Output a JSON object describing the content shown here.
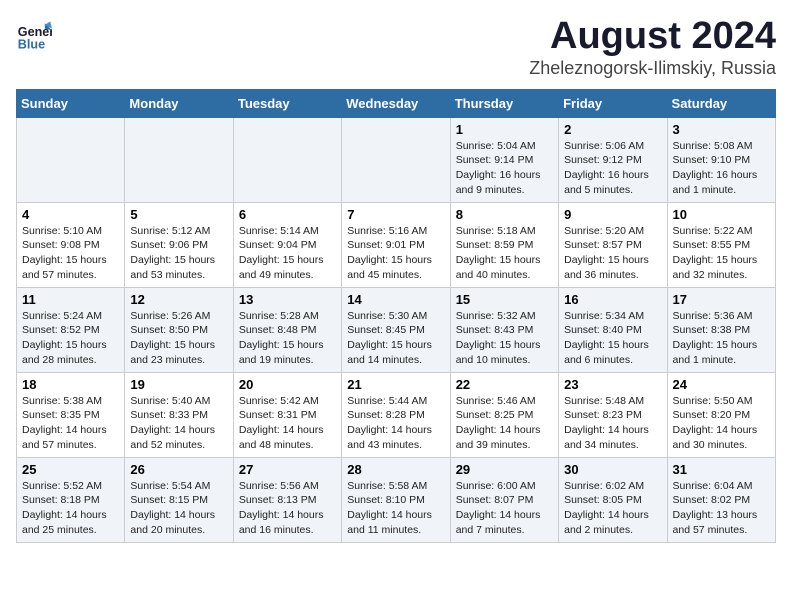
{
  "logo": {
    "line1": "General",
    "line2": "Blue"
  },
  "title": "August 2024",
  "subtitle": "Zheleznogorsk-Ilimskiy, Russia",
  "days_of_week": [
    "Sunday",
    "Monday",
    "Tuesday",
    "Wednesday",
    "Thursday",
    "Friday",
    "Saturday"
  ],
  "weeks": [
    [
      {
        "day": "",
        "text": ""
      },
      {
        "day": "",
        "text": ""
      },
      {
        "day": "",
        "text": ""
      },
      {
        "day": "",
        "text": ""
      },
      {
        "day": "1",
        "text": "Sunrise: 5:04 AM\nSunset: 9:14 PM\nDaylight: 16 hours\nand 9 minutes."
      },
      {
        "day": "2",
        "text": "Sunrise: 5:06 AM\nSunset: 9:12 PM\nDaylight: 16 hours\nand 5 minutes."
      },
      {
        "day": "3",
        "text": "Sunrise: 5:08 AM\nSunset: 9:10 PM\nDaylight: 16 hours\nand 1 minute."
      }
    ],
    [
      {
        "day": "4",
        "text": "Sunrise: 5:10 AM\nSunset: 9:08 PM\nDaylight: 15 hours\nand 57 minutes."
      },
      {
        "day": "5",
        "text": "Sunrise: 5:12 AM\nSunset: 9:06 PM\nDaylight: 15 hours\nand 53 minutes."
      },
      {
        "day": "6",
        "text": "Sunrise: 5:14 AM\nSunset: 9:04 PM\nDaylight: 15 hours\nand 49 minutes."
      },
      {
        "day": "7",
        "text": "Sunrise: 5:16 AM\nSunset: 9:01 PM\nDaylight: 15 hours\nand 45 minutes."
      },
      {
        "day": "8",
        "text": "Sunrise: 5:18 AM\nSunset: 8:59 PM\nDaylight: 15 hours\nand 40 minutes."
      },
      {
        "day": "9",
        "text": "Sunrise: 5:20 AM\nSunset: 8:57 PM\nDaylight: 15 hours\nand 36 minutes."
      },
      {
        "day": "10",
        "text": "Sunrise: 5:22 AM\nSunset: 8:55 PM\nDaylight: 15 hours\nand 32 minutes."
      }
    ],
    [
      {
        "day": "11",
        "text": "Sunrise: 5:24 AM\nSunset: 8:52 PM\nDaylight: 15 hours\nand 28 minutes."
      },
      {
        "day": "12",
        "text": "Sunrise: 5:26 AM\nSunset: 8:50 PM\nDaylight: 15 hours\nand 23 minutes."
      },
      {
        "day": "13",
        "text": "Sunrise: 5:28 AM\nSunset: 8:48 PM\nDaylight: 15 hours\nand 19 minutes."
      },
      {
        "day": "14",
        "text": "Sunrise: 5:30 AM\nSunset: 8:45 PM\nDaylight: 15 hours\nand 14 minutes."
      },
      {
        "day": "15",
        "text": "Sunrise: 5:32 AM\nSunset: 8:43 PM\nDaylight: 15 hours\nand 10 minutes."
      },
      {
        "day": "16",
        "text": "Sunrise: 5:34 AM\nSunset: 8:40 PM\nDaylight: 15 hours\nand 6 minutes."
      },
      {
        "day": "17",
        "text": "Sunrise: 5:36 AM\nSunset: 8:38 PM\nDaylight: 15 hours\nand 1 minute."
      }
    ],
    [
      {
        "day": "18",
        "text": "Sunrise: 5:38 AM\nSunset: 8:35 PM\nDaylight: 14 hours\nand 57 minutes."
      },
      {
        "day": "19",
        "text": "Sunrise: 5:40 AM\nSunset: 8:33 PM\nDaylight: 14 hours\nand 52 minutes."
      },
      {
        "day": "20",
        "text": "Sunrise: 5:42 AM\nSunset: 8:31 PM\nDaylight: 14 hours\nand 48 minutes."
      },
      {
        "day": "21",
        "text": "Sunrise: 5:44 AM\nSunset: 8:28 PM\nDaylight: 14 hours\nand 43 minutes."
      },
      {
        "day": "22",
        "text": "Sunrise: 5:46 AM\nSunset: 8:25 PM\nDaylight: 14 hours\nand 39 minutes."
      },
      {
        "day": "23",
        "text": "Sunrise: 5:48 AM\nSunset: 8:23 PM\nDaylight: 14 hours\nand 34 minutes."
      },
      {
        "day": "24",
        "text": "Sunrise: 5:50 AM\nSunset: 8:20 PM\nDaylight: 14 hours\nand 30 minutes."
      }
    ],
    [
      {
        "day": "25",
        "text": "Sunrise: 5:52 AM\nSunset: 8:18 PM\nDaylight: 14 hours\nand 25 minutes."
      },
      {
        "day": "26",
        "text": "Sunrise: 5:54 AM\nSunset: 8:15 PM\nDaylight: 14 hours\nand 20 minutes."
      },
      {
        "day": "27",
        "text": "Sunrise: 5:56 AM\nSunset: 8:13 PM\nDaylight: 14 hours\nand 16 minutes."
      },
      {
        "day": "28",
        "text": "Sunrise: 5:58 AM\nSunset: 8:10 PM\nDaylight: 14 hours\nand 11 minutes."
      },
      {
        "day": "29",
        "text": "Sunrise: 6:00 AM\nSunset: 8:07 PM\nDaylight: 14 hours\nand 7 minutes."
      },
      {
        "day": "30",
        "text": "Sunrise: 6:02 AM\nSunset: 8:05 PM\nDaylight: 14 hours\nand 2 minutes."
      },
      {
        "day": "31",
        "text": "Sunrise: 6:04 AM\nSunset: 8:02 PM\nDaylight: 13 hours\nand 57 minutes."
      }
    ]
  ]
}
